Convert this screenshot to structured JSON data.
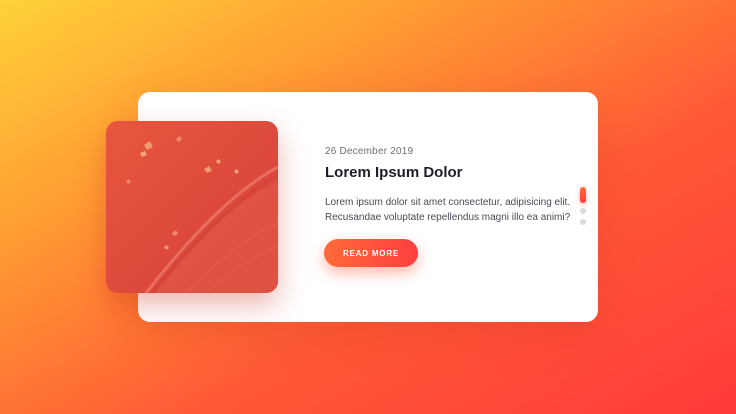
{
  "slide": {
    "date": "26 December 2019",
    "title": "Lorem Ipsum Dolor",
    "description": "Lorem ipsum dolor sit amet consectetur, adipisicing elit. Recusandae voluptate repellendus magni illo ea animi?",
    "button_label": "READ MORE"
  },
  "pagination": {
    "count": 3,
    "active_index": 0
  },
  "colors": {
    "accent": "#ff4a3c",
    "card_background": "#ffffff",
    "title_text": "#1e1e2a"
  }
}
